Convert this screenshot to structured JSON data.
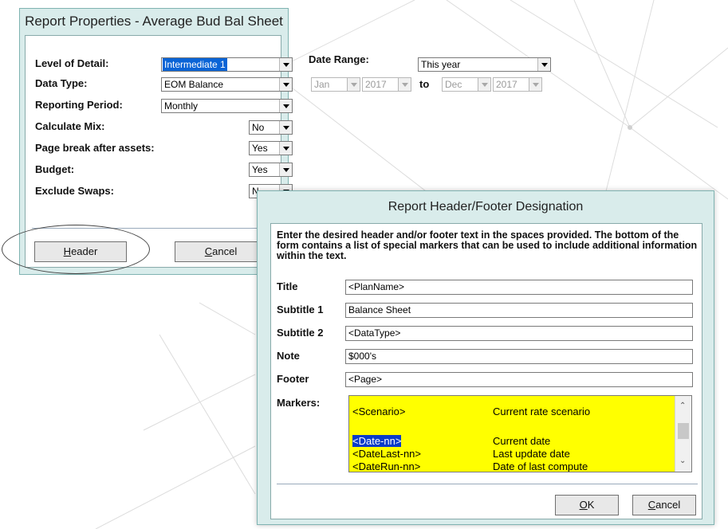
{
  "report_dialog": {
    "title": "Report Properties - Average Bud Bal Sheet",
    "level_of_detail": {
      "label": "Level of Detail:",
      "value": "Intermediate 1"
    },
    "date_range": {
      "label": "Date Range:",
      "value": "This year"
    },
    "data_type": {
      "label": "Data Type:",
      "value": "EOM Balance"
    },
    "date_from_month": "Jan",
    "date_from_year": "2017",
    "date_to_label": "to",
    "date_to_month": "Dec",
    "date_to_year": "2017",
    "reporting_period": {
      "label": "Reporting Period:",
      "value": "Monthly"
    },
    "calculate_mix": {
      "label": "Calculate Mix:",
      "value": "No"
    },
    "page_break": {
      "label": "Page break after assets:",
      "value": "Yes"
    },
    "budget": {
      "label": "Budget:",
      "value": "Yes"
    },
    "exclude_swaps": {
      "label": "Exclude Swaps:",
      "value": "N"
    },
    "header_button": "Header",
    "cancel_button": "Cancel"
  },
  "hf_dialog": {
    "title": "Report Header/Footer Designation",
    "description": "Enter the desired header and/or footer text in the spaces provided.  The bottom of the form contains a list of special markers that can be used to include additional information within the text.",
    "fields": [
      {
        "label": "Title",
        "value": "<PlanName>"
      },
      {
        "label": "Subtitle 1",
        "value": "Balance Sheet"
      },
      {
        "label": "Subtitle 2",
        "value": "<DataType>"
      },
      {
        "label": "Note",
        "value": "$000's"
      },
      {
        "label": "Footer",
        "value": "<Page>"
      }
    ],
    "markers_label": "Markers:",
    "markers": [
      {
        "token": "<Scenario>",
        "desc": "Current rate scenario"
      },
      {
        "token": "<Date-nn>",
        "desc": "Current date"
      },
      {
        "token": "<DateLast-nn>",
        "desc": "Last update date"
      },
      {
        "token": "<DateRun-nn>",
        "desc": "Date of last compute"
      }
    ],
    "ok_button": "OK",
    "cancel_button": "Cancel"
  }
}
